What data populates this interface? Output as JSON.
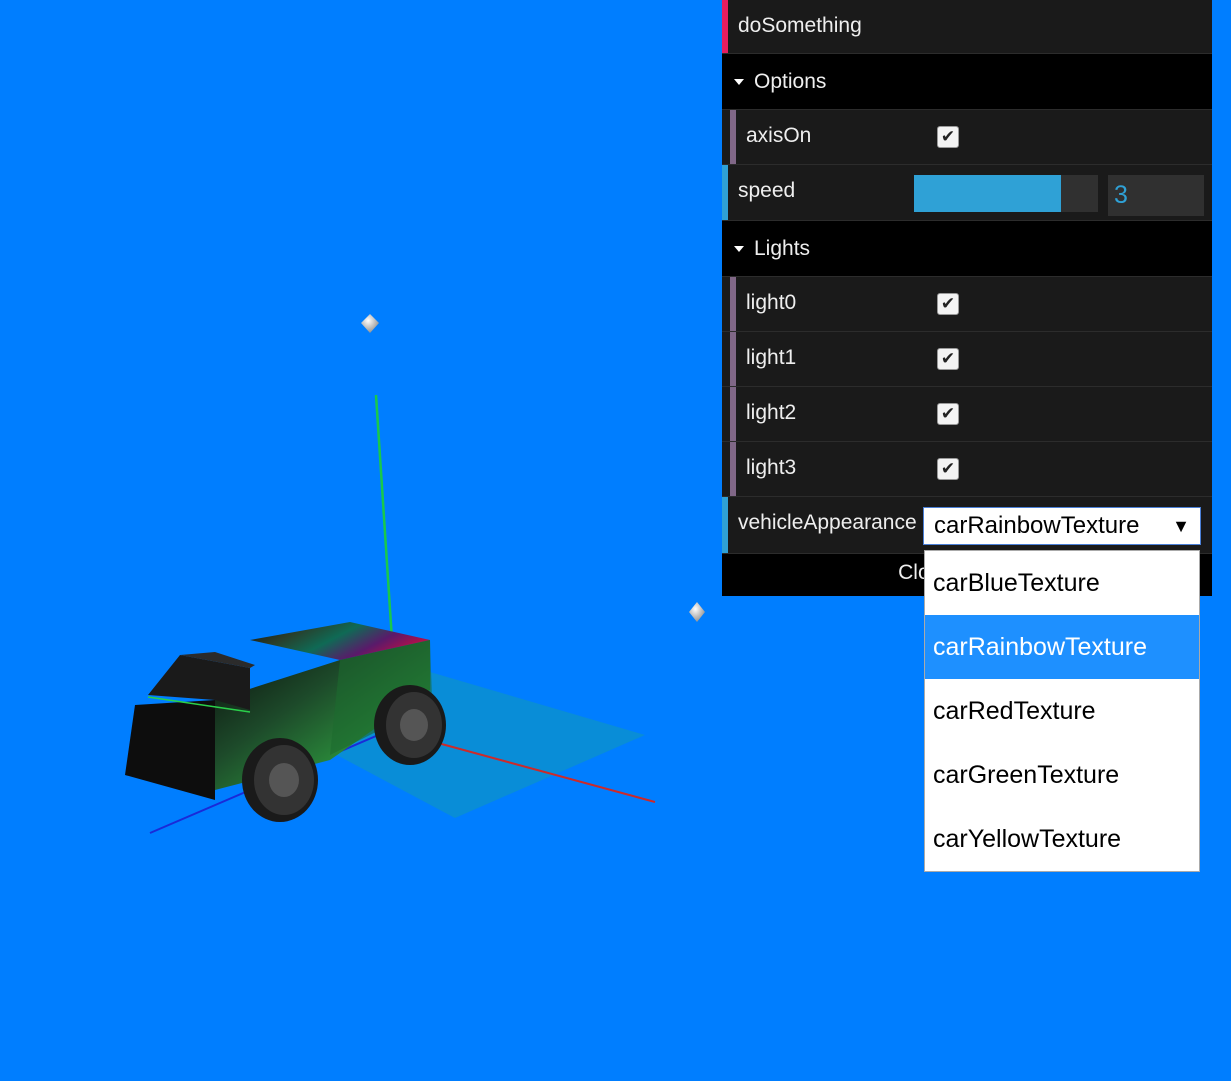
{
  "scene": {
    "background_color": "#007eff"
  },
  "gui": {
    "doSomething_label": "doSomething",
    "options_folder": {
      "title": "Options",
      "axisOn_label": "axisOn",
      "axisOn_checked": true,
      "speed_label": "speed",
      "speed_value": "3",
      "speed_fill_fraction": 0.8
    },
    "lights_folder": {
      "title": "Lights",
      "items": [
        {
          "label": "light0",
          "checked": true
        },
        {
          "label": "light1",
          "checked": true
        },
        {
          "label": "light2",
          "checked": true
        },
        {
          "label": "light3",
          "checked": true
        }
      ]
    },
    "vehicle": {
      "label": "vehicleAppearance",
      "selected": "carRainbowTexture",
      "options": [
        "carBlueTexture",
        "carRainbowTexture",
        "carRedTexture",
        "carGreenTexture",
        "carYellowTexture"
      ]
    },
    "close_label": "Close Controls",
    "colors": {
      "function_stripe": "#e61d5f",
      "boolean_stripe": "#806787",
      "number_stripe": "#2fa1d6",
      "slider_fill": "#2fa1d6",
      "dropdown_highlight": "#1e90ff"
    }
  }
}
